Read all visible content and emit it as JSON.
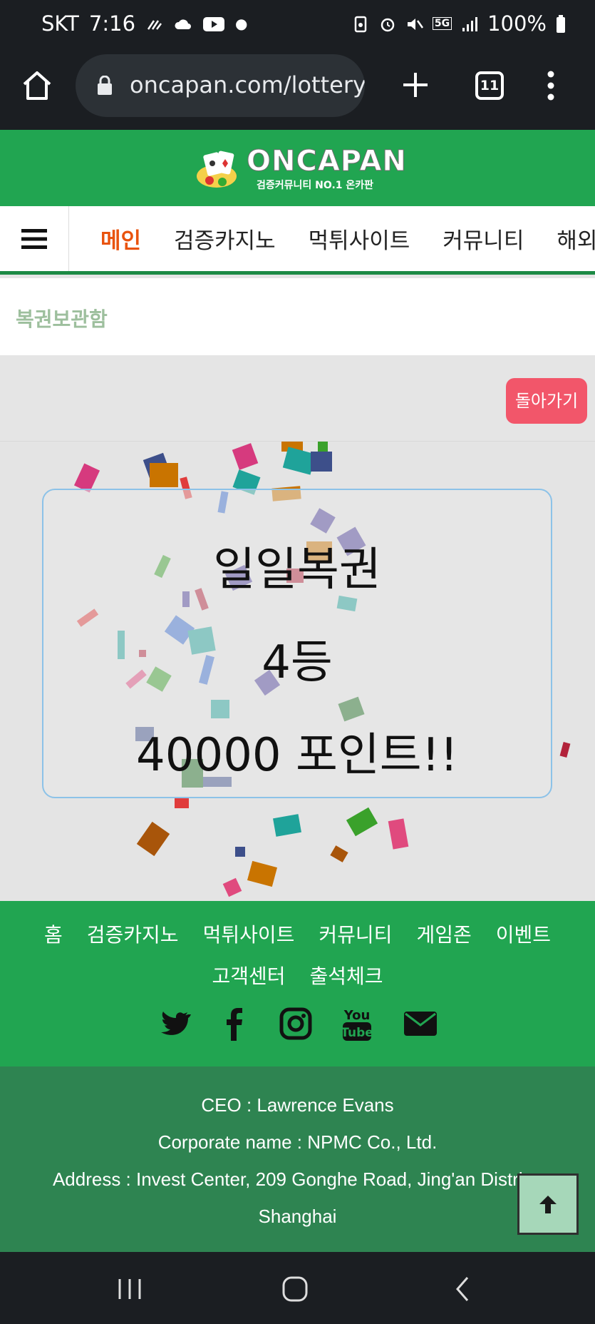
{
  "status_bar": {
    "carrier": "SKT",
    "time": "7:16",
    "network": "5G",
    "battery": "100%"
  },
  "browser": {
    "url": "oncapan.com/lottery",
    "tab_count": "11"
  },
  "site": {
    "logo_title": "ONCAPAN",
    "logo_subtitle": "검증커뮤니티 NO.1 온카판"
  },
  "nav": {
    "items": [
      {
        "label": "메인"
      },
      {
        "label": "검증카지노"
      },
      {
        "label": "먹튀사이트"
      },
      {
        "label": "커뮤니티"
      },
      {
        "label": "해외"
      }
    ]
  },
  "page": {
    "breadcrumb": "복권보관함",
    "back_label": "돌아가기"
  },
  "result": {
    "lottery_name": "일일복권",
    "rank": "4등",
    "prize": "40000 포인트!!"
  },
  "footer": {
    "links_row1": [
      "홈",
      "검증카지노",
      "먹튀사이트",
      "커뮤니티",
      "게임존",
      "이벤트"
    ],
    "links_row2": [
      "고객센터",
      "출석체크"
    ],
    "ceo": "CEO : Lawrence Evans",
    "corporate": "Corporate name : NPMC Co., Ltd.",
    "address": "Address : Invest Center, 209 Gonghe Road, Jing'an District, Shanghai"
  },
  "colors": {
    "brand_green": "#21a551",
    "footer_green": "#2e8451",
    "active_nav": "#e9530e",
    "back_button": "#f2566a"
  },
  "icons": [
    "home-icon",
    "lock-icon",
    "plus-icon",
    "tabs-icon",
    "more-icon",
    "menu-icon",
    "twitter-icon",
    "facebook-icon",
    "instagram-icon",
    "youtube-icon",
    "mail-icon",
    "arrow-up-icon"
  ]
}
